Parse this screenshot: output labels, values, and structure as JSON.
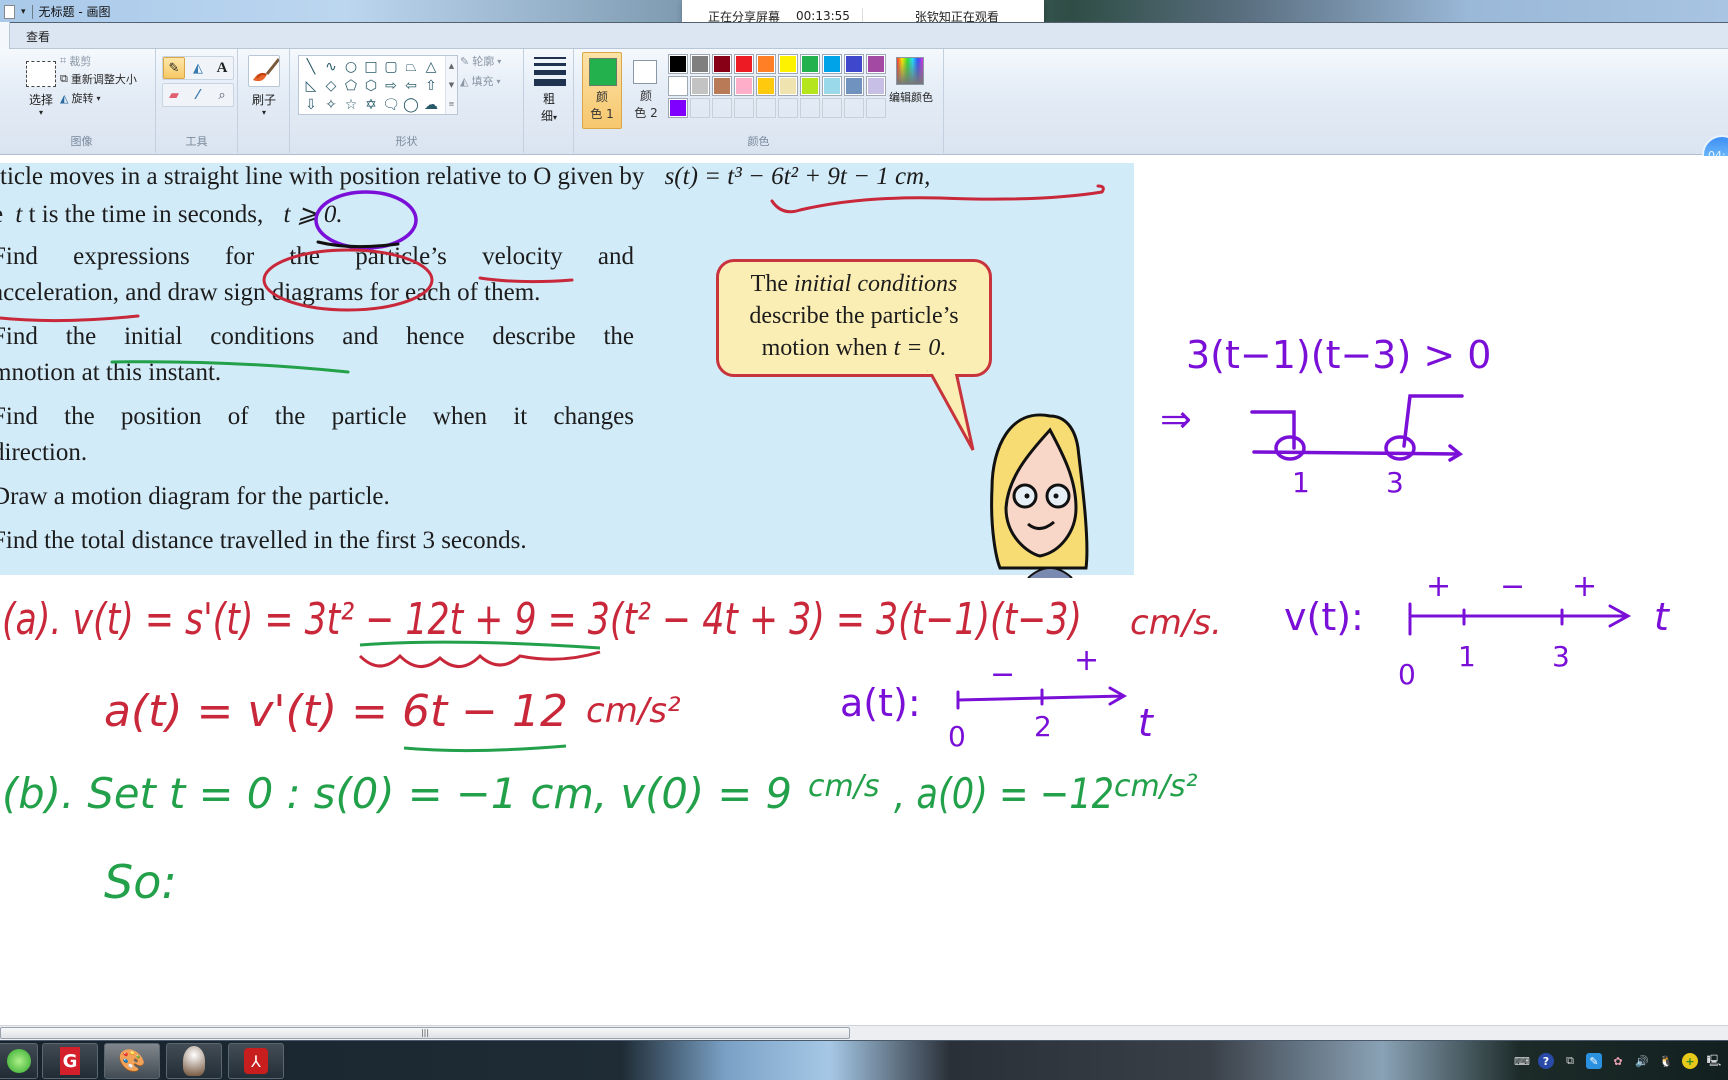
{
  "window": {
    "title": "无标题 - 画图",
    "quick_access_arrow": "▾"
  },
  "share_banner": {
    "status": "正在分享屏幕",
    "elapsed": "00:13:55",
    "viewer": "张钦知正在观看"
  },
  "tabs": [
    {
      "label": "查看"
    }
  ],
  "ribbon": {
    "image_group": {
      "label": "图像",
      "select": "选择",
      "crop": "裁剪",
      "resize": "重新调整大小",
      "rotate": "旋转"
    },
    "tools_group": {
      "label": "工具",
      "tools": [
        {
          "name": "pencil",
          "glyph": "✎",
          "active": true
        },
        {
          "name": "fill",
          "glyph": "◭",
          "active": false
        },
        {
          "name": "text",
          "glyph": "A",
          "active": false
        },
        {
          "name": "eraser",
          "glyph": "▰",
          "active": false
        },
        {
          "name": "color-picker",
          "glyph": "⁄",
          "active": false
        },
        {
          "name": "magnifier",
          "glyph": "⌕",
          "active": false
        }
      ]
    },
    "brushes": {
      "label": "刷子"
    },
    "shapes_group": {
      "label": "形状",
      "shapes": [
        "╲",
        "∿",
        "○",
        "□",
        "▢",
        "⏢",
        "△",
        "◺",
        "◇",
        "⬠",
        "⬡",
        "⇨",
        "⇦",
        "⇧",
        "⇩",
        "✧",
        "☆",
        "✡",
        "🗨",
        "◯",
        "☁"
      ],
      "outline": "轮廓",
      "fill": "填充"
    },
    "size": {
      "label_top": "粗",
      "label_bottom": "细"
    },
    "colors_group": {
      "label": "颜色",
      "color1_label_top": "颜",
      "color1_label_bottom": "色 1",
      "color1": "#22b14c",
      "color2_label_top": "颜",
      "color2_label_bottom": "色 2",
      "color2": "#ffffff",
      "palette": [
        "#000000",
        "#7f7f7f",
        "#880015",
        "#ed1c24",
        "#ff7f27",
        "#fff200",
        "#22b14c",
        "#00a2e8",
        "#3f48cc",
        "#a349a4",
        "#ffffff",
        "#c3c3c3",
        "#b97a57",
        "#ffaec9",
        "#ffc90e",
        "#efe4b0",
        "#b5e61d",
        "#99d9ea",
        "#7092be",
        "#c8bfe7",
        "#7f00ff",
        "",
        "",
        "",
        "",
        "",
        "",
        "",
        "",
        ""
      ],
      "edit_colors": "编辑颜色"
    },
    "timer_bubble": "04:"
  },
  "canvas": {
    "problem": {
      "line1_a": "ticle moves in a straight line with position relative to O given by",
      "line1_formula": "s(t) = t³ − 6t² + 9t − 1 cm,",
      "line2_a": "t is the time in seconds,",
      "line2_b": "t ⩾ 0.",
      "line2_prefix": "e",
      "parts": [
        "ind expressions for the particle’s velocity and",
        "cceleration, and draw sign diagrams for each of them.",
        "ind the initial conditions and hence describe the",
        "notion at this instant.",
        "ind the position of the particle when it changes",
        "irection.",
        "raw a motion diagram for the particle.",
        "ind the total distance travelled in the first 3 seconds."
      ],
      "part_prefixes": [
        "F",
        "a",
        "F",
        "m",
        "F",
        "d",
        "D",
        "F"
      ]
    },
    "speech_bubble": {
      "line1_a": "The",
      "line1_b": "initial conditions",
      "line2": "describe the particle’s",
      "line3_a": "motion when",
      "line3_b": "t = 0."
    },
    "handwriting": {
      "inequality": "3(t−1)(t−3) > 0",
      "implies": "⇒",
      "v_sign_chart_roots": [
        "1",
        "3"
      ],
      "part_a_velocity": "(a). v(t) = s'(t) = 3t² − 12t + 9 = 3(t² − 4t + 3) = 3(t−1)(t−3)",
      "velocity_unit": "cm/s.",
      "part_a_accel": "a(t) = v'(t) = 6t − 12",
      "accel_unit": "cm/s²",
      "a_sign_label": "a(t):",
      "a_sign_signs": [
        "−",
        "+"
      ],
      "a_sign_ticks": [
        "0",
        "2"
      ],
      "a_sign_axis": "t",
      "v_sign_label": "v(t):",
      "v_sign_signs": [
        "+",
        "−",
        "+"
      ],
      "v_sign_ticks": [
        "0",
        "1",
        "3"
      ],
      "v_sign_axis": "t",
      "part_b": "(b). Set t = 0 :  s(0) = −1 cm,   v(0) = 9",
      "part_b_v_unit": "cm/s",
      "part_b_a": ", a(0) = −12",
      "part_b_a_unit": "cm/s²",
      "so": "So:"
    },
    "ink_colors": {
      "red": "#c8283a",
      "green": "#22a04a",
      "purple": "#7a10d8",
      "black": "#111111"
    }
  },
  "scrollbar": {
    "thumb_grip": "|||"
  },
  "taskbar": {
    "apps": [
      "ie",
      "game",
      "paint",
      "media",
      "pdf"
    ],
    "tray": [
      "keyboard",
      "help",
      "windows",
      "pen",
      "flower",
      "volume",
      "qq",
      "add",
      "network"
    ]
  }
}
